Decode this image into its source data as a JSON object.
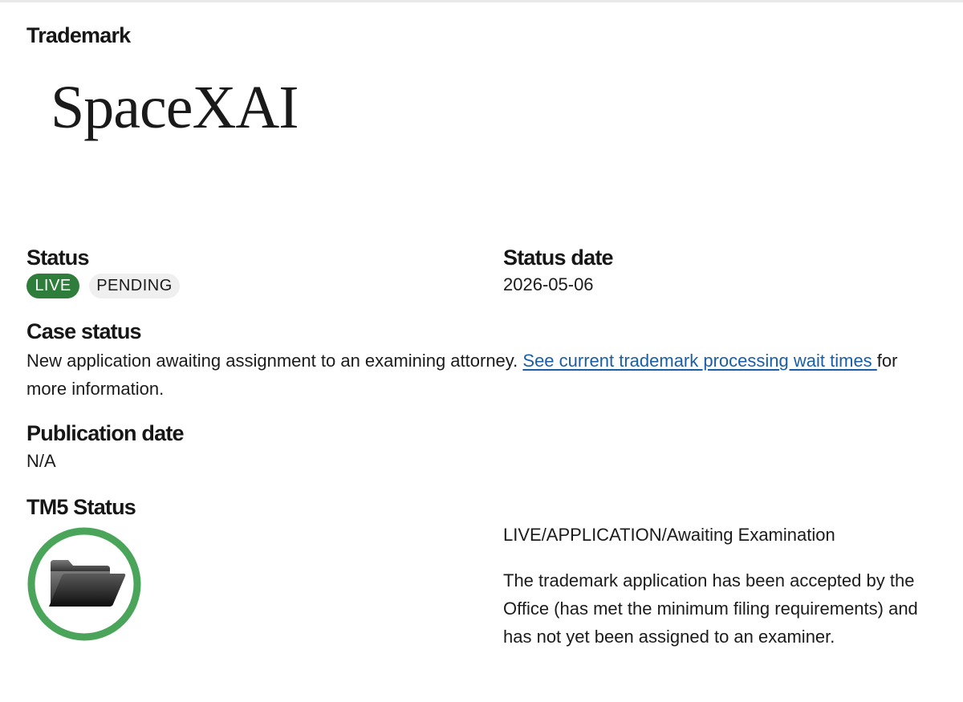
{
  "trademark": {
    "heading": "Trademark",
    "mark_text": "SpaceXAI"
  },
  "status": {
    "heading": "Status",
    "tags": [
      "LIVE",
      "PENDING"
    ],
    "live_color": "#2e7d3a"
  },
  "status_date": {
    "heading": "Status date",
    "value": "2026-05-06"
  },
  "case_status": {
    "heading": "Case status",
    "text_before": "New application awaiting assignment to an examining attorney. ",
    "link_text": "See current trademark processing wait times ",
    "text_after": "for more information."
  },
  "publication_date": {
    "heading": "Publication date",
    "value": "N/A"
  },
  "tm5_status": {
    "heading": "TM5 Status",
    "icon": "open-folder-icon",
    "ring_color": "#4aa55a",
    "summary": "LIVE/APPLICATION/Awaiting Examination",
    "description": "The trademark application has been accepted by the Office (has met the minimum filing requirements) and has not yet been assigned to an examiner."
  }
}
